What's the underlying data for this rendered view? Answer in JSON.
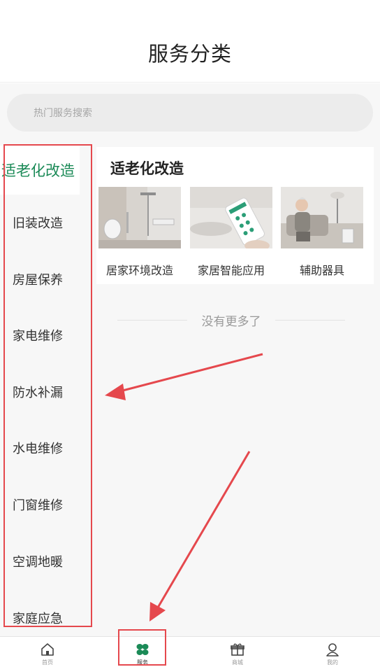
{
  "header": {
    "title": "服务分类"
  },
  "search": {
    "placeholder": "热门服务搜索"
  },
  "sidebar": {
    "items": [
      {
        "label": "适老化改造",
        "active": true
      },
      {
        "label": "旧装改造"
      },
      {
        "label": "房屋保养"
      },
      {
        "label": "家电维修"
      },
      {
        "label": "防水补漏"
      },
      {
        "label": "水电维修"
      },
      {
        "label": "门窗维修"
      },
      {
        "label": "空调地暖"
      },
      {
        "label": "家庭应急"
      }
    ]
  },
  "panel": {
    "title": "适老化改造",
    "cards": [
      {
        "label": "居家环境改造",
        "icon": "bathroom-photo"
      },
      {
        "label": "家居智能应用",
        "icon": "smartphone-photo"
      },
      {
        "label": "辅助器具",
        "icon": "elderly-person-photo"
      }
    ]
  },
  "no_more": "没有更多了",
  "tabbar": {
    "tabs": [
      {
        "label": "首页",
        "icon": "home-icon"
      },
      {
        "label": "服务",
        "icon": "clover-icon",
        "active": true
      },
      {
        "label": "商城",
        "icon": "gift-icon"
      },
      {
        "label": "我的",
        "icon": "user-icon"
      }
    ]
  },
  "colors": {
    "accent": "#1b8a57",
    "annotation": "#e5484d"
  }
}
